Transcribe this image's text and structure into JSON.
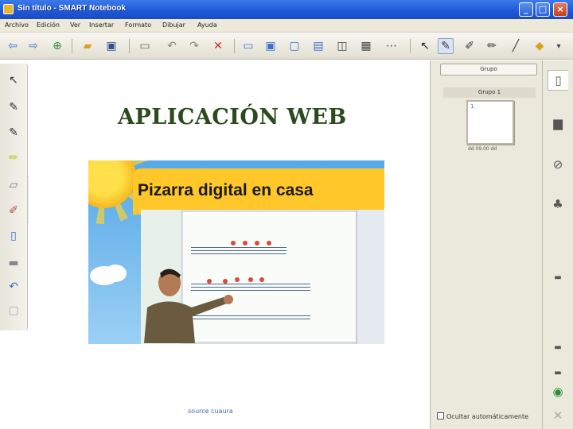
{
  "window": {
    "title": "Sin título - SMART Notebook"
  },
  "menu": [
    "Archivo",
    "Edición",
    "Ver",
    "Insertar",
    "Formato",
    "Dibujar",
    "Ayuda"
  ],
  "toolbar": {
    "icons": [
      "back-arrow-icon",
      "forward-arrow-icon",
      "add-page-icon",
      "open-folder-icon",
      "save-icon",
      "paste-icon",
      "undo-icon",
      "redo-icon",
      "delete-icon",
      "screen-shade-icon",
      "display-icon",
      "capture-icon",
      "table-icon",
      "select-icon",
      "pen-icon",
      "highlighter-icon",
      "line-icon",
      "fill-icon"
    ]
  },
  "canvas": {
    "title": "APLICACIÓN WEB",
    "image_banner": "Pizarra digital en casa",
    "page_link": "source cuaura"
  },
  "side_panel": {
    "group_button": "Grupo",
    "group_label": "Grupo 1",
    "thumbnail_number": "1",
    "thumbnail_caption": "dd.09.00 dd",
    "auto_hide": "Ocultar automáticamente"
  },
  "colors": {
    "titlebar": "#1f56d6",
    "page_title": "#2c4a1e",
    "banner": "#ffc72a"
  }
}
